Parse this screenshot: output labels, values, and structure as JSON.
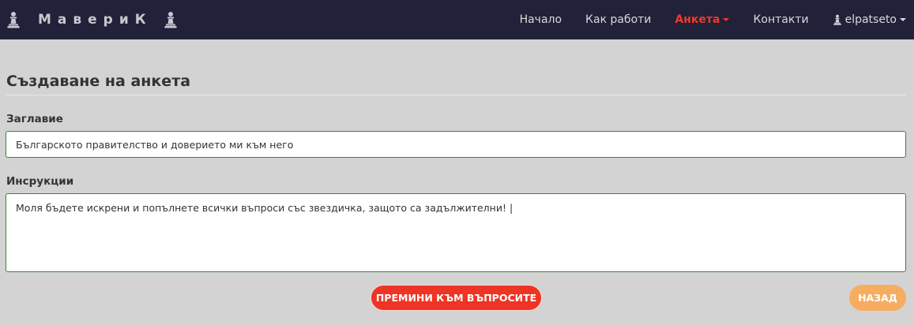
{
  "navbar": {
    "brand": "МавериК",
    "items": [
      {
        "label": "Начало"
      },
      {
        "label": "Как работи"
      },
      {
        "label": "Анкета",
        "active": true
      },
      {
        "label": "Контакти"
      }
    ],
    "user": "elpatseto"
  },
  "form": {
    "heading": "Създаване на анкета",
    "title_label": "Заглавие",
    "title_value": "Българското правителство и доверието ми към него",
    "instructions_label": "Инсрукции",
    "instructions_value": "Моля бъдете искрени и попълнете всички въпроси със звездичка, защото са задължителни! |"
  },
  "actions": {
    "next_label": "ПРЕМИНИ КЪМ ВЪПРОСИТЕ",
    "back_label": "НАЗАД"
  },
  "colors": {
    "navbar_bg": "#22213a",
    "accent": "#ee3424",
    "back": "#f6ad60",
    "page_bg": "#d3d3d3"
  }
}
